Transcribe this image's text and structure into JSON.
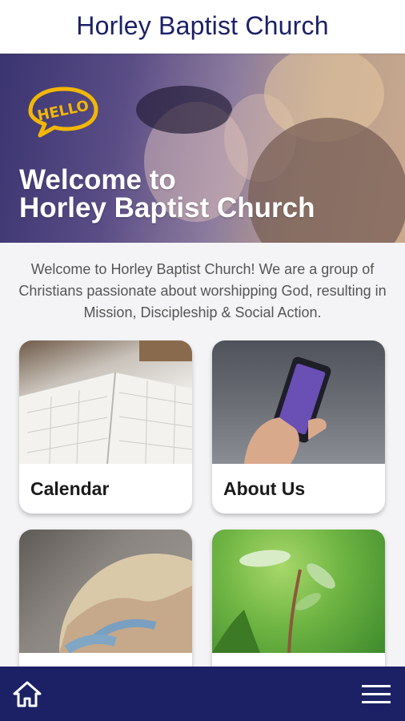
{
  "header": {
    "title": "Horley Baptist Church"
  },
  "hero": {
    "bubble_text": "HELLO",
    "welcome_line1": "Welcome to",
    "welcome_line2": "Horley Baptist Church"
  },
  "intro": {
    "text": "Welcome to Horley Baptist Church! We are a group of Christians passionate about worshipping God, resulting in Mission, Discipleship & Social Action."
  },
  "cards": [
    {
      "label": "Calendar"
    },
    {
      "label": "About Us"
    }
  ],
  "bottom_nav": {
    "home_icon": "home-icon",
    "menu_icon": "hamburger-menu-icon"
  },
  "colors": {
    "brand": "#1c2166",
    "accent": "#f2b705"
  }
}
